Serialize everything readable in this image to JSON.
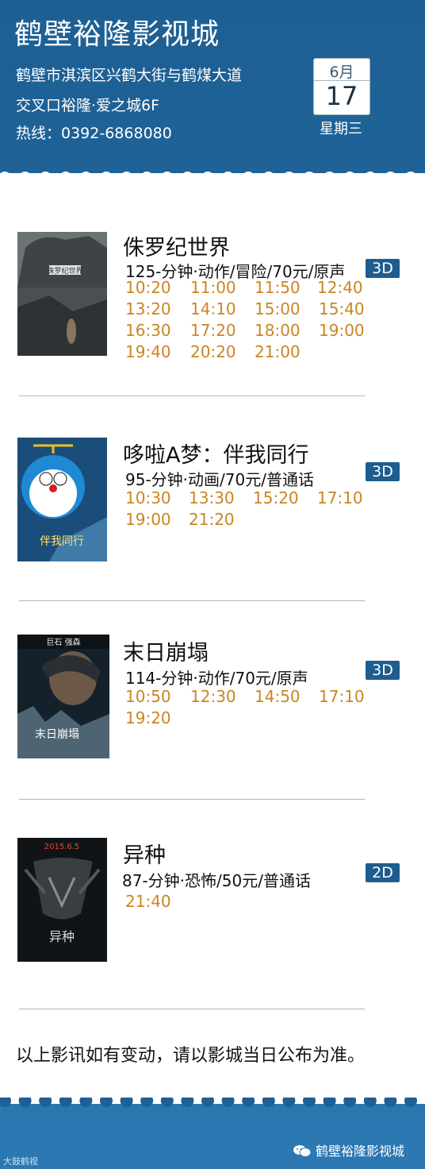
{
  "header": {
    "title": "鹤壁裕隆影视城",
    "address_line1": "鹤壁市淇滨区兴鹤大街与鹤煤大道",
    "address_line2": "交叉口裕隆·爱之城6F",
    "hotline": "热线：0392-6868080",
    "calendar": {
      "month": "6月",
      "day": "17",
      "weekday": "星期三"
    }
  },
  "movies": [
    {
      "title": "侏罗纪世界",
      "meta": "125-分钟·动作/冒险/70元/原声",
      "format": "3D",
      "poster_text": "侏罗纪世界",
      "times": [
        "10:20",
        "11:00",
        "11:50",
        "12:40",
        "13:20",
        "14:10",
        "15:00",
        "15:40",
        "16:30",
        "17:20",
        "18:00",
        "19:00",
        "19:40",
        "20:20",
        "21:00"
      ]
    },
    {
      "title": "哆啦A梦：伴我同行",
      "meta": "95-分钟·动画/70元/普通话",
      "format": "3D",
      "poster_text": "伴我同行",
      "times": [
        "10:30",
        "13:30",
        "15:20",
        "17:10",
        "19:00",
        "21:20"
      ]
    },
    {
      "title": "末日崩塌",
      "meta": "114-分钟·动作/70元/原声",
      "format": "3D",
      "poster_text": "末日崩塌",
      "poster_top": "巨石 强森",
      "times": [
        "10:50",
        "12:30",
        "14:50",
        "17:10",
        "19:20"
      ]
    },
    {
      "title": "异种",
      "meta": "87-分钟·恐怖/50元/普通话",
      "format": "2D",
      "poster_text": "异种",
      "poster_top": "2015.6.5",
      "times": [
        "21:40"
      ]
    }
  ],
  "notice": "以上影讯如有变动，请以影城当日公布为准。",
  "footer": {
    "account": "鹤壁裕隆影视城",
    "watermark": "大鼓鹤视"
  },
  "colors": {
    "header_blue": "#1f5f93",
    "time_orange": "#c98622",
    "badge_blue": "#1f5d8e"
  }
}
